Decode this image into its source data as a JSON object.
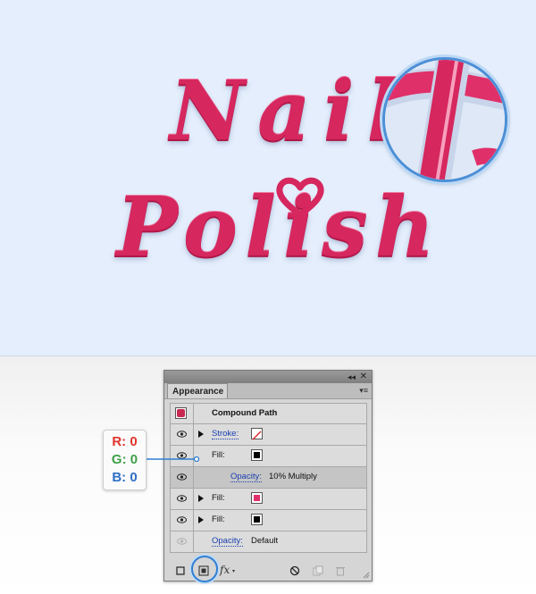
{
  "artwork": {
    "line1": "Nail",
    "line2": "Polish",
    "text_color": "#d6275f",
    "background": "#e4eefc"
  },
  "panel": {
    "tab": "Appearance",
    "collapse_glyph": "◂◂",
    "close_glyph": "✕",
    "menu_glyph": "▾≡",
    "rows": [
      {
        "label": "Compound Path",
        "swatch": "#c8284f"
      },
      {
        "label": "Stroke:",
        "swatch": "none",
        "expanded_arrow": true
      },
      {
        "label": "Fill:",
        "swatch": "#000000"
      },
      {
        "label": "Opacity:",
        "value": "10% Multiply"
      },
      {
        "label": "Fill:",
        "swatch": "#e0306a",
        "expanded_arrow": true
      },
      {
        "label": "Fill:",
        "swatch": "#000000",
        "expanded_arrow": true
      },
      {
        "label": "Opacity:",
        "value": "Default"
      }
    ],
    "bottom_icons": [
      "new-art-icon",
      "add-fill-icon",
      "fx-icon",
      "clear-icon",
      "duplicate-icon",
      "trash-icon"
    ],
    "fx_label": "fx"
  },
  "callout": {
    "r": "R: 0",
    "g": "G: 0",
    "b": "B: 0",
    "r_color": "#e0342c",
    "g_color": "#3fa048",
    "b_color": "#2f6fc4"
  }
}
